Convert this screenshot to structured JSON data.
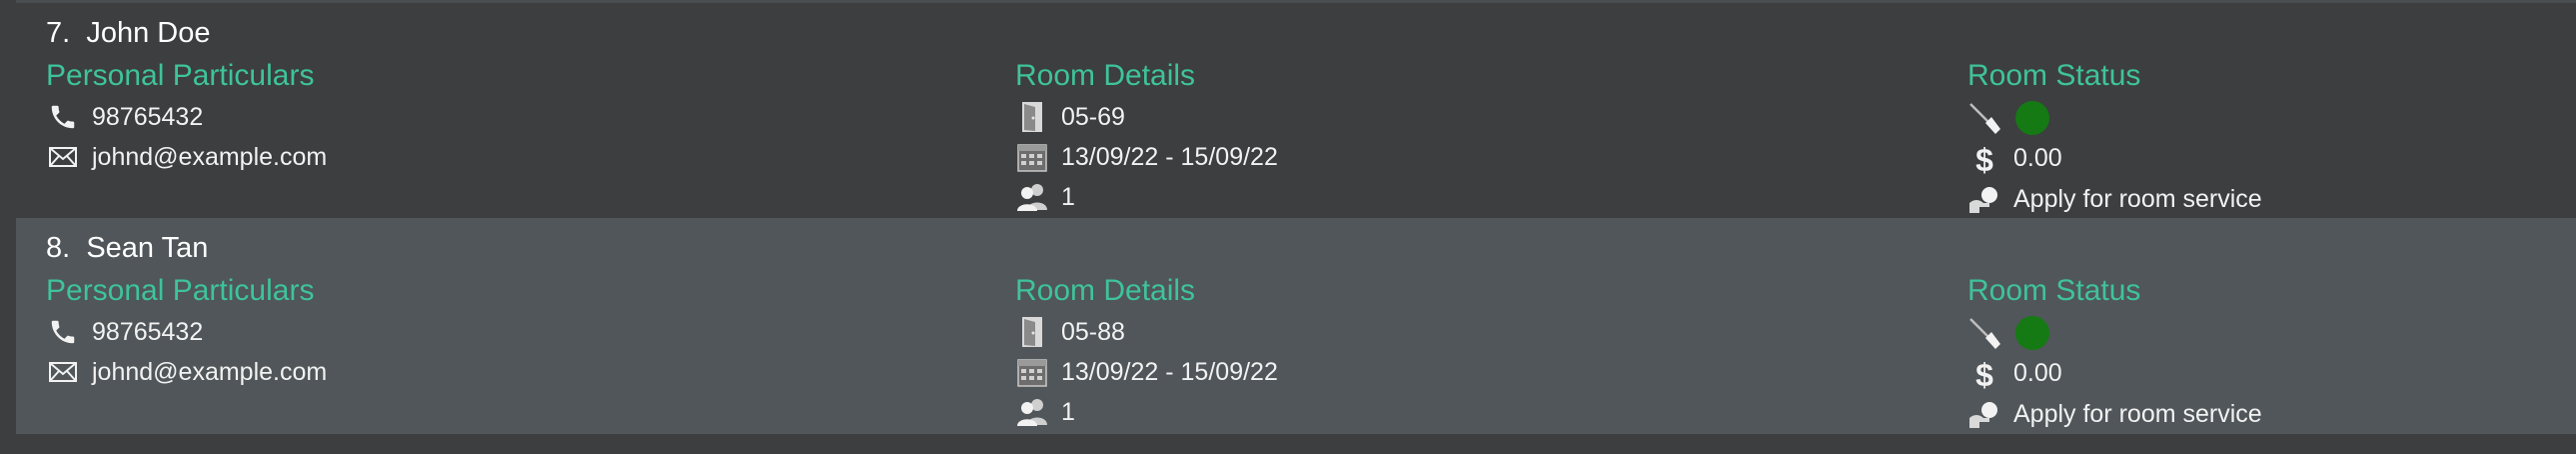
{
  "persons": [
    {
      "index": "7.",
      "name": "John Doe",
      "personal_heading": "Personal Particulars",
      "phone": "98765432",
      "email": "johnd@example.com",
      "room_heading": "Room Details",
      "room_number": "05-69",
      "dates": "13/09/22 - 15/09/22",
      "guests": "1",
      "status_heading": "Room Status",
      "clean_status_color": "#157a13",
      "bill": "0.00",
      "service": "Apply for room service"
    },
    {
      "index": "8.",
      "name": "Sean Tan",
      "personal_heading": "Personal Particulars",
      "phone": "98765432",
      "email": "johnd@example.com",
      "room_heading": "Room Details",
      "room_number": "05-88",
      "dates": "13/09/22 - 15/09/22",
      "guests": "1",
      "status_heading": "Room Status",
      "clean_status_color": "#157a13",
      "bill": "0.00",
      "service": "Apply for room service"
    }
  ],
  "icons": {
    "phone": "phone-icon",
    "email": "envelope-icon",
    "room": "door-icon",
    "dates": "calendar-icon",
    "guests": "people-icon",
    "cleaning": "broom-icon",
    "bill": "dollar-icon",
    "service": "bell-hand-icon"
  },
  "colors": {
    "heading": "#3fc39a",
    "card_even": "#3c3e40",
    "card_odd": "#505659"
  }
}
